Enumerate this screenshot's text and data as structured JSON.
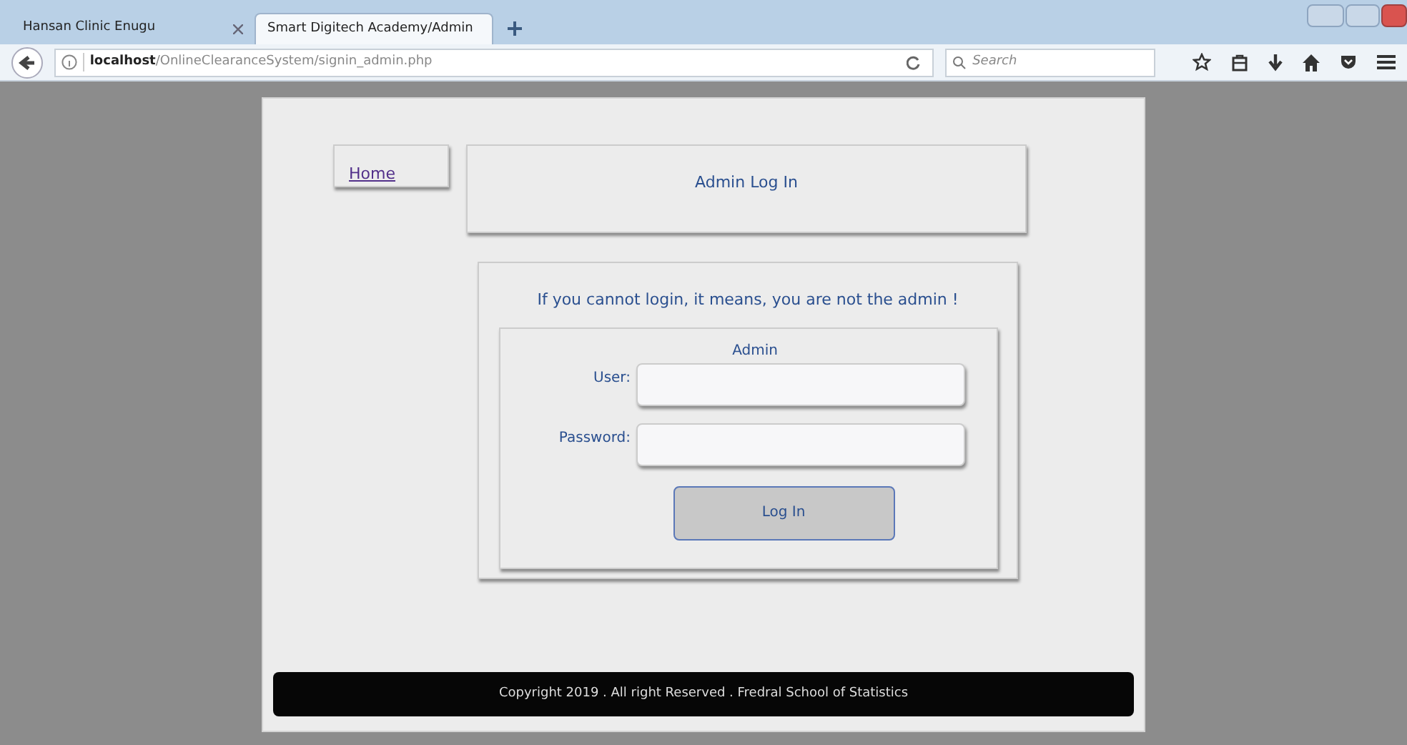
{
  "browser": {
    "tabs": [
      {
        "title": "Hansan Clinic Enugu",
        "selected": false
      },
      {
        "title": "Smart Digitech Academy/Admin",
        "selected": true
      }
    ],
    "url_host": "localhost",
    "url_path": "/OnlineClearanceSystem/signin_admin.php",
    "search": {
      "placeholder": "Search"
    }
  },
  "page": {
    "home_link": "Home",
    "heading": "Admin Log In",
    "notice": "If you cannot login, it means, you are not the admin !",
    "form": {
      "legend": "Admin",
      "fields": [
        {
          "label": "User:"
        },
        {
          "label": "Password:"
        }
      ],
      "button": "Log In"
    },
    "footer": "Copyright 2019 . All right Reserved . Fredral School of Statistics"
  }
}
